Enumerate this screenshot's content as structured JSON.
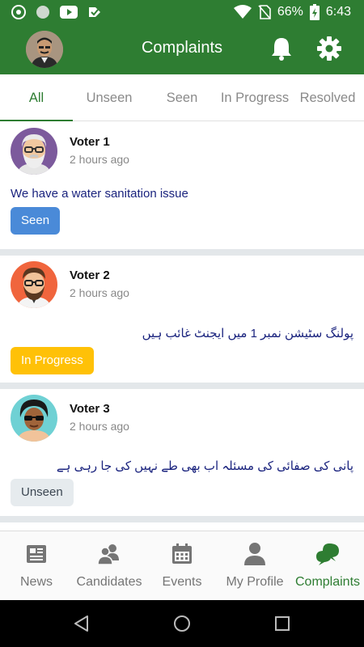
{
  "status_bar": {
    "battery": "66%",
    "time": "6:43"
  },
  "app_bar": {
    "title": "Complaints"
  },
  "tabs": [
    {
      "label": "All"
    },
    {
      "label": "Unseen"
    },
    {
      "label": "Seen"
    },
    {
      "label": "In Progress"
    },
    {
      "label": "Resolved"
    }
  ],
  "complaints": [
    {
      "name": "Voter 1",
      "time": "2 hours ago",
      "text": "We have a water sanitation issue",
      "status": "Seen"
    },
    {
      "name": "Voter 2",
      "time": "2 hours ago",
      "text": "پولنگ سٹیشن نمبر 1 میں ایجنٹ غائب ہیں",
      "status": "In Progress"
    },
    {
      "name": "Voter 3",
      "time": "2 hours ago",
      "text": "پانی کی صفائی کی مسئلہ اب بھی طے نہیں کی جا رہی ہے",
      "status": "Unseen"
    }
  ],
  "bottom_nav": [
    {
      "label": "News",
      "icon": "news-icon"
    },
    {
      "label": "Candidates",
      "icon": "candidates-icon"
    },
    {
      "label": "Events",
      "icon": "calendar-icon"
    },
    {
      "label": "My Profile",
      "icon": "profile-icon"
    },
    {
      "label": "Complaints",
      "icon": "chat-bubbles-icon"
    }
  ],
  "colors": {
    "primary": "#2e7d32",
    "seen": "#4a8ad8",
    "in_progress": "#ffc107",
    "unseen": "#e6ebee"
  }
}
